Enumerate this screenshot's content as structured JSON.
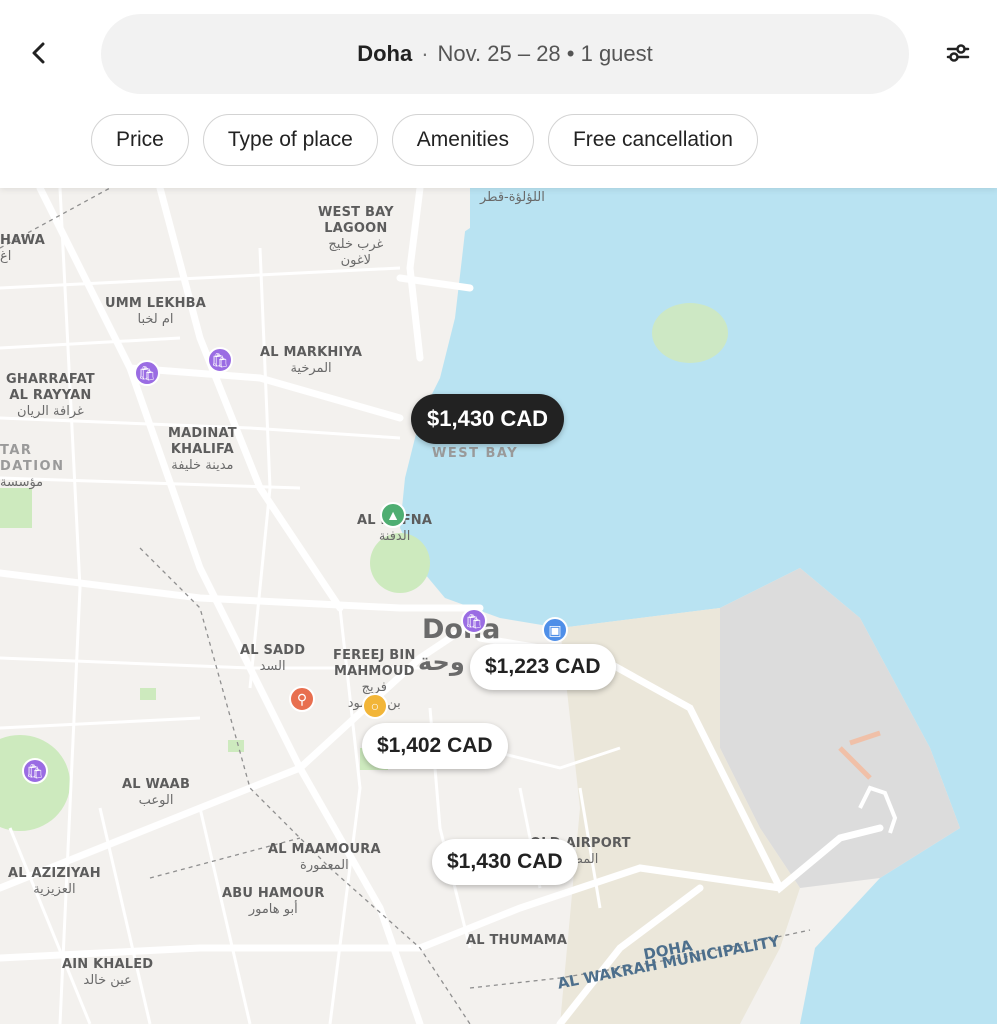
{
  "search": {
    "city": "Doha",
    "separator": "·",
    "details": "Nov. 25 – 28 • 1 guest"
  },
  "icons": {
    "back": "chevron-left-icon",
    "filters": "sliders-icon"
  },
  "filters": [
    "Price",
    "Type of place",
    "Amenities",
    "Free cancellation"
  ],
  "map": {
    "city_label": "Doha",
    "city_label_ar": "وحة",
    "labels": {
      "west_bay_lagoon": {
        "en": "WEST BAY\nLAGOON",
        "ar": "غرب خليج\nلاغون"
      },
      "pearl": {
        "ar": "اللؤلؤة-قطر"
      },
      "umm_lekhba": {
        "en": "UMM LEKHBA",
        "ar": "ام لخبا"
      },
      "al_markhiya": {
        "en": "AL MARKHIYA",
        "ar": "المرخية"
      },
      "gharrafat": {
        "en": "GHARRAFAT\nAL RAYYAN",
        "ar": "غرافة الريان"
      },
      "madinat": {
        "en": "MADINAT\nKHALIFA",
        "ar": "مدينة خليفة"
      },
      "west_bay": {
        "en": "WEST BAY"
      },
      "al_dafna": {
        "en": "AL DAFNA",
        "ar": "الدفنة"
      },
      "al_sadd": {
        "en": "AL SADD",
        "ar": "السد"
      },
      "fereej": {
        "en": "FEREEJ BIN\nMAHMOUD",
        "ar": "فريج\nبن محمود"
      },
      "al_waab": {
        "en": "AL WAAB",
        "ar": "الوعب"
      },
      "al_maamoura": {
        "en": "AL MAAMOURA",
        "ar": "المعمورة"
      },
      "airport": {
        "en": "OLD AIRPORT",
        "ar": "المطار"
      },
      "al_aziziyah": {
        "en": "AL AZIZIYAH",
        "ar": "العزيزية"
      },
      "abu_hamour": {
        "en": "ABU HAMOUR",
        "ar": "أبو هامور"
      },
      "al_thumama": {
        "en": "AL THUMAMA"
      },
      "ain_khaled": {
        "en": "AIN KHALED",
        "ar": "عين خالد"
      },
      "hawa": {
        "en": "HAWA",
        "ar": "اغ"
      },
      "foundation": {
        "en": "TAR\nDATION",
        "ar": "مؤسسة"
      },
      "muni_doha": {
        "en": "DOHA"
      },
      "muni_wakrah": {
        "en": "AL WAKRAH MUNICIPALITY"
      }
    },
    "prices": [
      {
        "label": "$1,430 CAD",
        "selected": true
      },
      {
        "label": "$1,223 CAD",
        "selected": false
      },
      {
        "label": "$1,402 CAD",
        "selected": false
      },
      {
        "label": "$1,430 CAD",
        "selected": false
      }
    ],
    "colors": {
      "water": "#b9e3f2",
      "land": "#f3f1ee",
      "park": "#cdeabe",
      "industrial": "#dcdcdc",
      "selected_pin": "#222222",
      "shopping_poi": "#9a6ce3",
      "restaurant_poi": "#e86f4f"
    }
  }
}
